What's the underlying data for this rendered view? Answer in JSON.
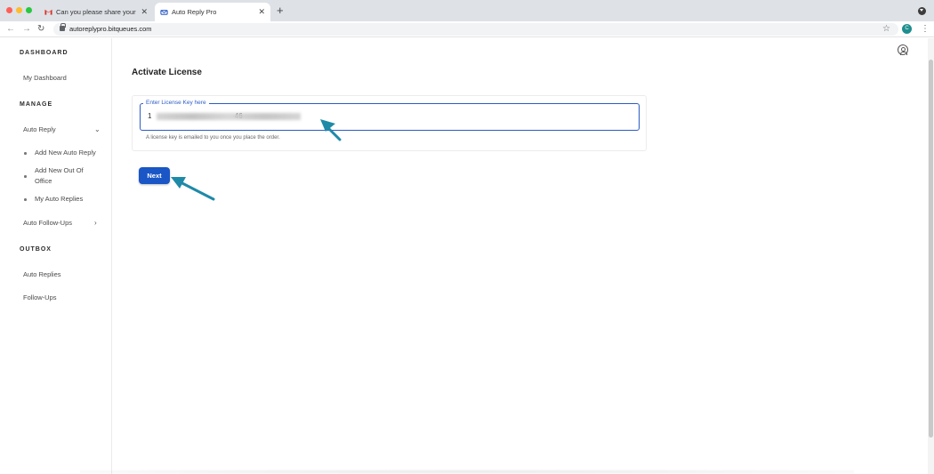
{
  "browser": {
    "tabs": [
      {
        "label": "Can you please share your me",
        "icon": "gmail-icon",
        "active": false
      },
      {
        "label": "Auto Reply Pro",
        "icon": "app-icon",
        "active": true
      }
    ],
    "new_tab": "+",
    "url": "autoreplypro.bitqueues.com",
    "profile_initial": "C"
  },
  "sidebar": {
    "dashboard_title": "DASHBOARD",
    "my_dashboard": "My Dashboard",
    "manage_title": "MANAGE",
    "auto_reply": "Auto Reply",
    "add_new_auto_reply": "Add New Auto Reply",
    "add_new_out_of_office": "Add New Out Of Office",
    "my_auto_replies": "My Auto Replies",
    "auto_follow_ups": "Auto Follow-Ups",
    "outbox_title": "OUTBOX",
    "auto_replies": "Auto Replies",
    "follow_ups": "Follow-Ups"
  },
  "main": {
    "title": "Activate License",
    "field_label": "Enter License Key here",
    "field_value": "1                                          46",
    "helper": "A license key is emailed to you once you place the order.",
    "next_label": "Next"
  },
  "colors": {
    "accent": "#1a56c6",
    "annotation_arrow": "#1f8aa8"
  }
}
